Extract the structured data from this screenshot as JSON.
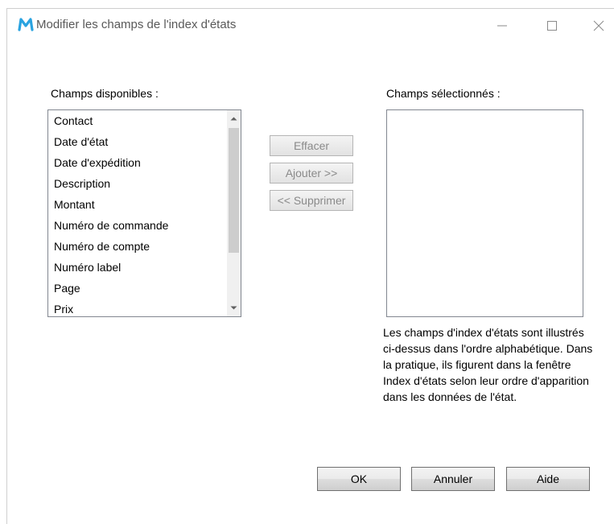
{
  "window": {
    "title": "Modifier les champs de l'index d'états",
    "app_icon": "m-logo-icon",
    "controls": [
      "minimize-icon",
      "maximize-icon",
      "close-icon"
    ]
  },
  "available": {
    "label": "Champs disponibles :",
    "items": [
      "Contact",
      "Date d'état",
      "Date d'expédition",
      "Description",
      "Montant",
      "Numéro de commande",
      "Numéro de compte",
      "Numéro label",
      "Page",
      "Prix"
    ]
  },
  "selected": {
    "label": "Champs sélectionnés :",
    "items": []
  },
  "middle_buttons": {
    "clear": "Effacer",
    "add": "Ajouter >>",
    "remove": "<< Supprimer"
  },
  "info_text": "Les champs d'index d'états sont illustrés ci-dessus dans l'ordre alphabétique. Dans la pratique, ils figurent dans la fenêtre Index d'états selon leur ordre d'apparition dans les données de l'état.",
  "footer": {
    "ok": "OK",
    "cancel": "Annuler",
    "help": "Aide"
  },
  "colors": {
    "accent": "#2aa3e0",
    "disabled_text": "#8a8a8a",
    "title_text": "#595959"
  }
}
